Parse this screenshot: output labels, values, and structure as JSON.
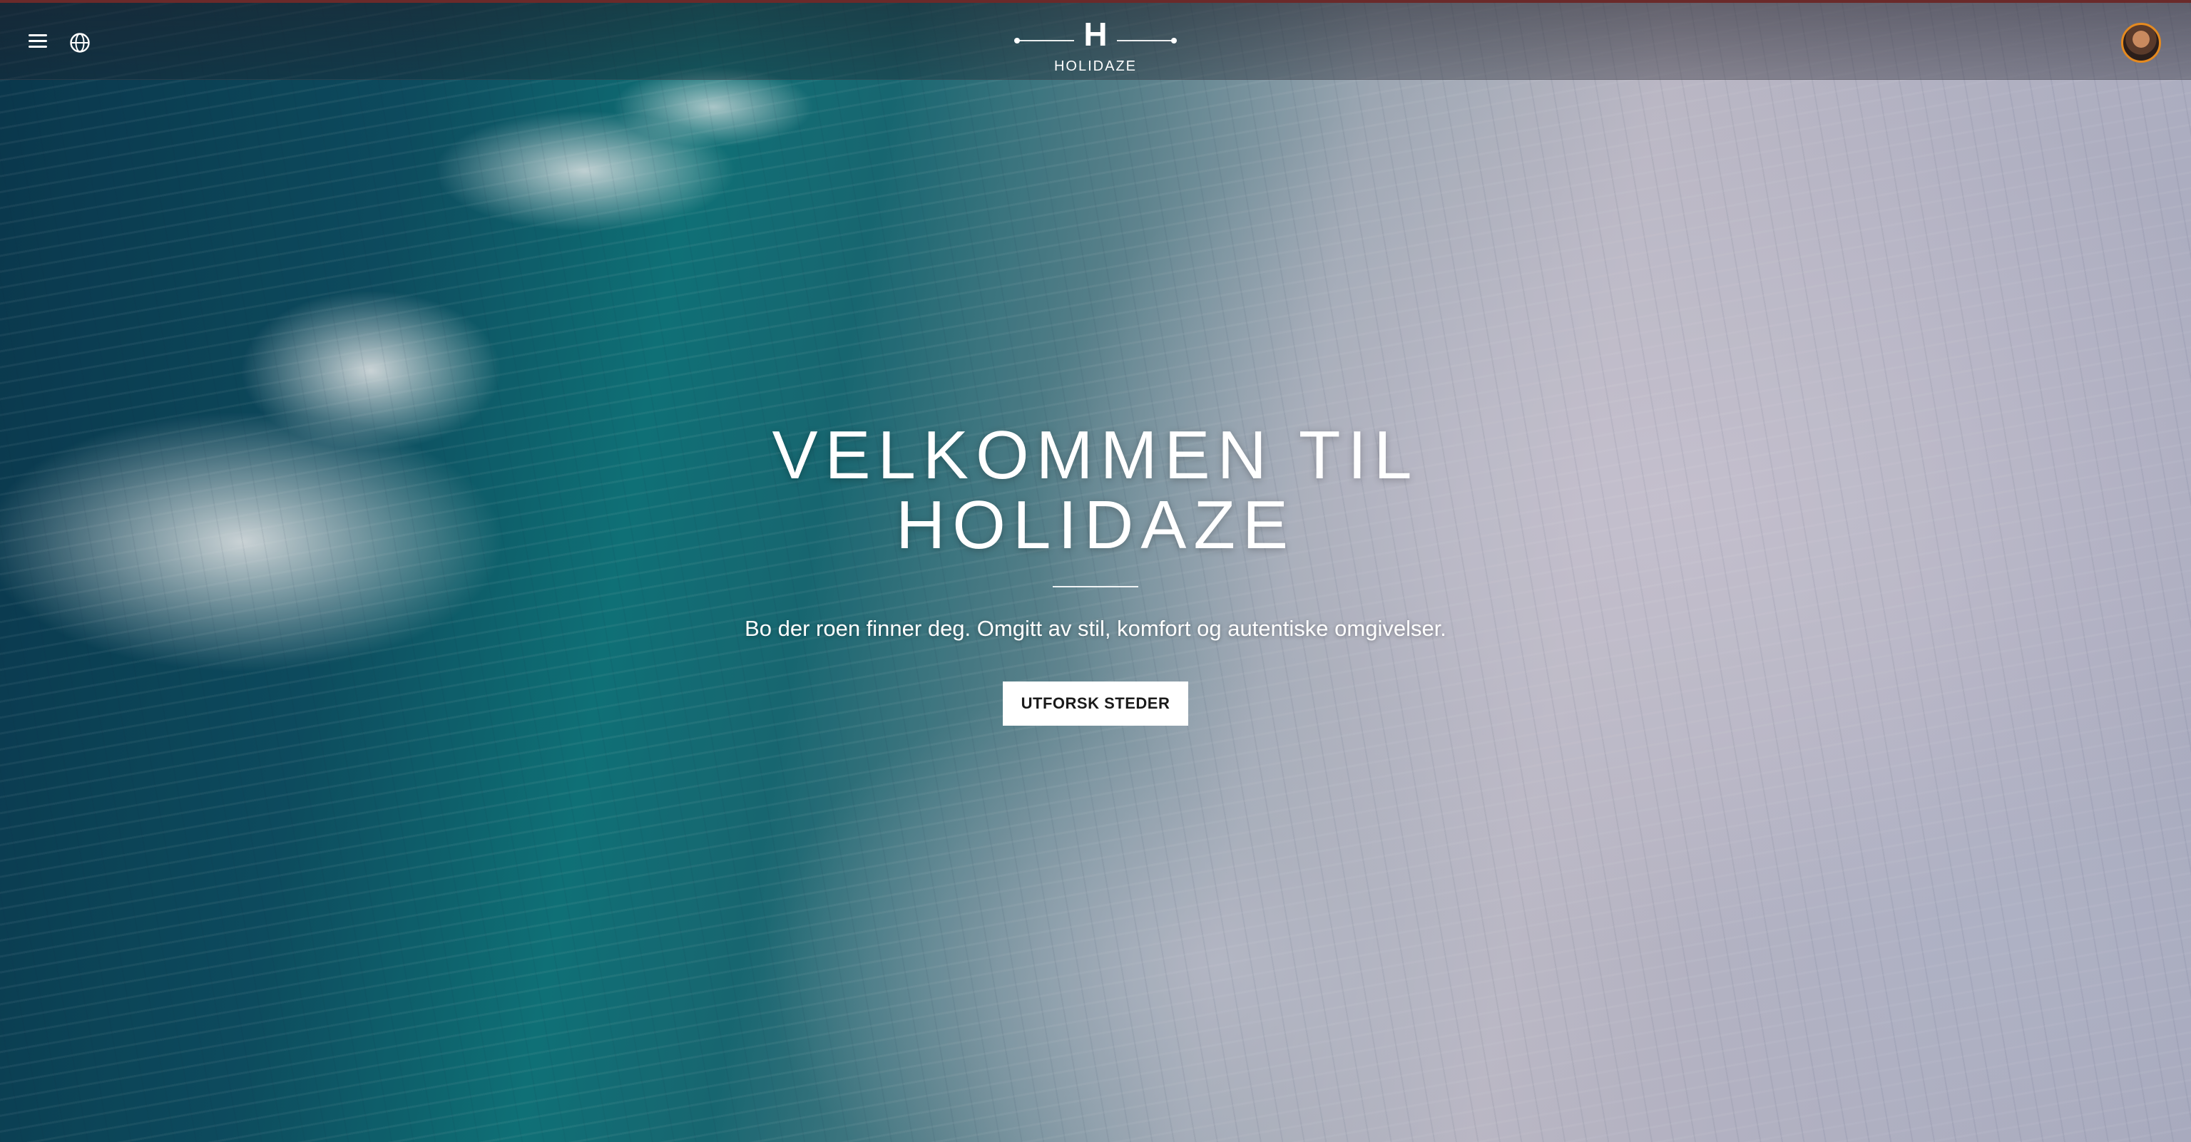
{
  "header": {
    "logo_letter": "H",
    "logo_text": "HOLIDAZE"
  },
  "hero": {
    "title_line1": "VELKOMMEN TIL",
    "title_line2": "HOLIDAZE",
    "subtitle": "Bo der roen finner deg. Omgitt av stil, komfort og autentiske omgivelser.",
    "cta_label": "UTFORSK STEDER"
  },
  "icons": {
    "menu": "hamburger-menu-icon",
    "language": "globe-icon",
    "profile": "avatar"
  },
  "colors": {
    "topbar_accent": "#6b2a2a",
    "avatar_ring": "#e58a1f",
    "cta_bg": "#ffffff",
    "cta_text": "#1a1a1a"
  }
}
